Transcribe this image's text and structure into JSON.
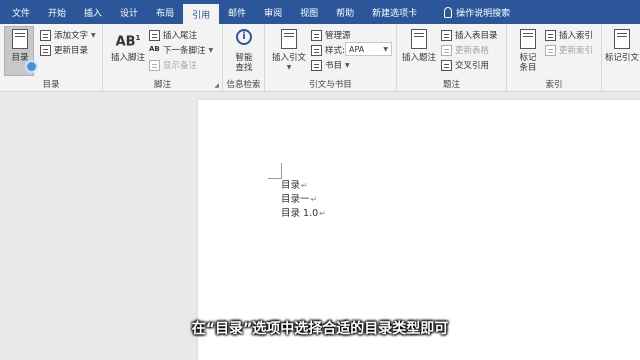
{
  "tabs": [
    "文件",
    "开始",
    "插入",
    "设计",
    "布局",
    "引用",
    "邮件",
    "审阅",
    "视图",
    "帮助",
    "新建选项卡"
  ],
  "active_tab_index": 5,
  "tell_me": "操作说明搜索",
  "groups": {
    "toc": {
      "label": "目录",
      "toc_button": "目录",
      "add_text": "添加文字",
      "update_toc": "更新目录"
    },
    "footnotes": {
      "label": "脚注",
      "insert_footnote": "插入脚注",
      "ab_icon": "AB",
      "ab_sup": "1",
      "insert_endnote": "插入尾注",
      "next_footnote": "下一条脚注",
      "show_notes": "显示备注"
    },
    "research": {
      "label": "信息检索",
      "smart_lookup_line1": "智能",
      "smart_lookup_line2": "查找"
    },
    "citations": {
      "label": "引文与书目",
      "insert_citation": "插入引文",
      "manage_sources": "管理源",
      "style_label": "样式:",
      "style_value": "APA",
      "bibliography": "书目"
    },
    "captions": {
      "label": "题注",
      "insert_caption": "插入题注",
      "insert_table_of_figures": "插入表目录",
      "update_table": "更新表格",
      "cross_reference": "交叉引用"
    },
    "index": {
      "label": "索引",
      "mark_entry_line1": "标记",
      "mark_entry_line2": "条目",
      "insert_index": "插入索引",
      "update_index": "更新索引"
    },
    "toa": {
      "mark_citation": "标记引文"
    }
  },
  "document": {
    "lines": [
      "目录",
      "目录一",
      "目录 1.0"
    ],
    "para_mark": "↵"
  },
  "subtitle": "在“目录”选项中选择合适的目录类型即可"
}
